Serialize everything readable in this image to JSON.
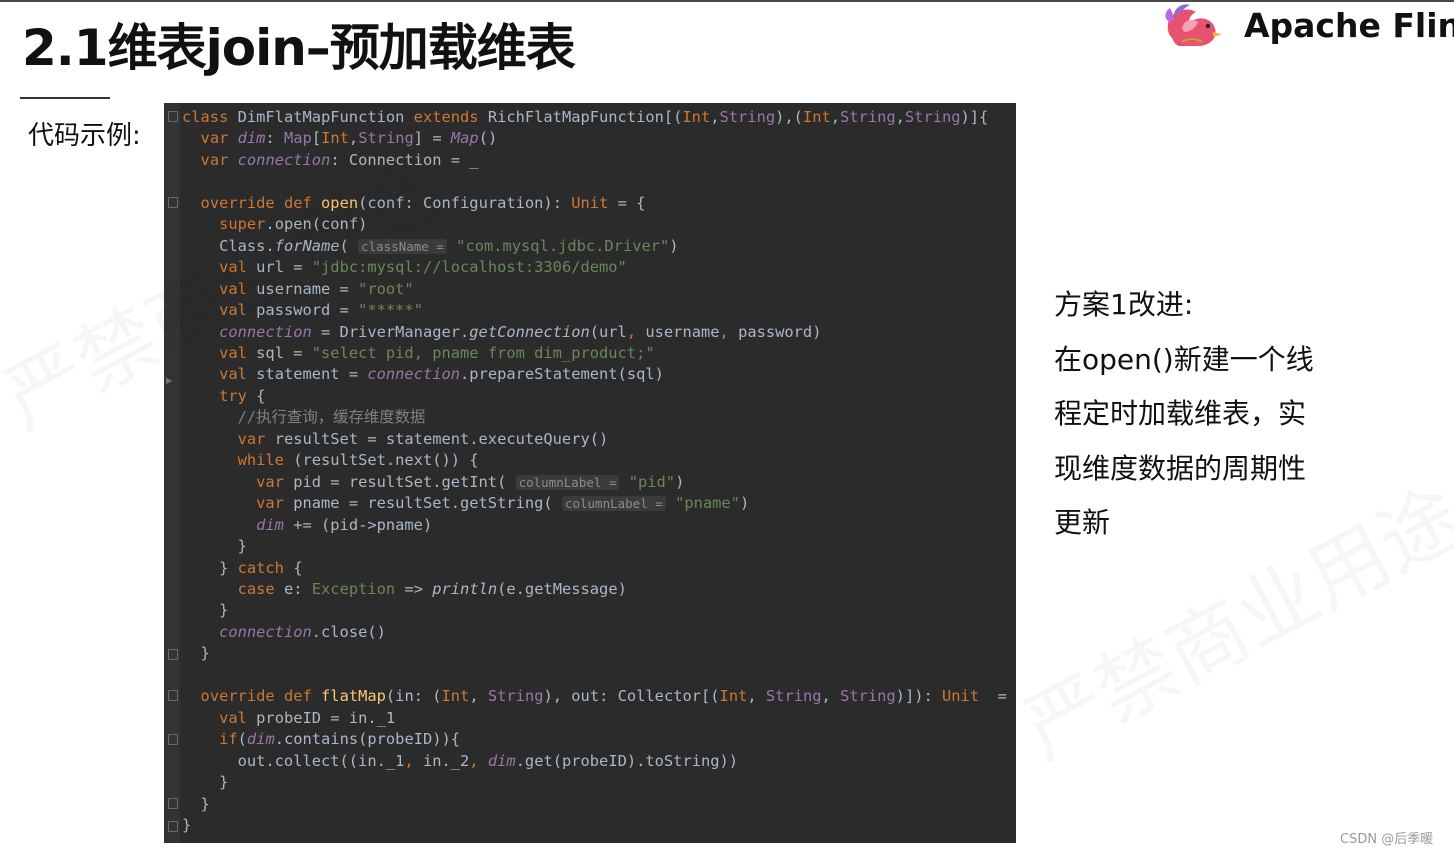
{
  "slide": {
    "title": "2.1维表join–预加载维表",
    "brand": "Apache Flink",
    "code_label": "代码示例:",
    "side_text": [
      "方案1改进:",
      "在open()新建一个线",
      "程定时加载维表，实",
      "现维度数据的周期性",
      "更新"
    ],
    "watermark": "严禁商业用途",
    "credit": "CSDN @后季暖"
  },
  "code": {
    "hints": {
      "class_name": "className =",
      "column_label": "columnLabel ="
    },
    "comment": "//执行查询，缓存维度数据",
    "strings": {
      "driver": "\"com.mysql.jdbc.Driver\"",
      "url": "\"jdbc:mysql://localhost:3306/demo\"",
      "user": "\"root\"",
      "password": "\"*****\"",
      "sql": "\"select pid, pname from dim_product;\"",
      "pid": "\"pid\"",
      "pname": "\"pname\""
    }
  },
  "colors": {
    "code_bg": "#2b2b2b",
    "keyword": "#cc7832",
    "field": "#9876aa",
    "string": "#6a8759",
    "function": "#ffc66d",
    "plain": "#a9b7c6"
  }
}
